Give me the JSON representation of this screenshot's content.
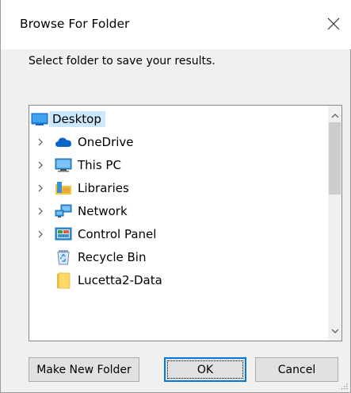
{
  "dialog": {
    "title": "Browse For Folder",
    "close_icon": "close-icon",
    "prompt": "Select folder to save your results."
  },
  "tree": {
    "root": {
      "label": "Desktop",
      "icon": "desktop-icon",
      "selected": true
    },
    "items": [
      {
        "label": "OneDrive",
        "icon": "onedrive-cloud-icon",
        "expandable": true,
        "color": "#0a64c8"
      },
      {
        "label": "This PC",
        "icon": "computer-icon",
        "expandable": true,
        "color": "#2f8fd8"
      },
      {
        "label": "Libraries",
        "icon": "libraries-icon",
        "expandable": true,
        "color": "#f3c63e"
      },
      {
        "label": "Network",
        "icon": "network-icon",
        "expandable": true,
        "color": "#2f8fd8"
      },
      {
        "label": "Control Panel",
        "icon": "control-panel-icon",
        "expandable": true,
        "color": "#3c9b3c"
      },
      {
        "label": "Recycle Bin",
        "icon": "recycle-bin-icon",
        "expandable": false,
        "color": "#6f8fb0"
      },
      {
        "label": "Lucetta2-Data",
        "icon": "folder-icon",
        "expandable": false,
        "color": "#ffd966"
      }
    ]
  },
  "buttons": {
    "make_new_folder": "Make New Folder",
    "ok": "OK",
    "cancel": "Cancel"
  },
  "colors": {
    "selection": "#cce8ff",
    "focus_border": "#0078d7"
  }
}
